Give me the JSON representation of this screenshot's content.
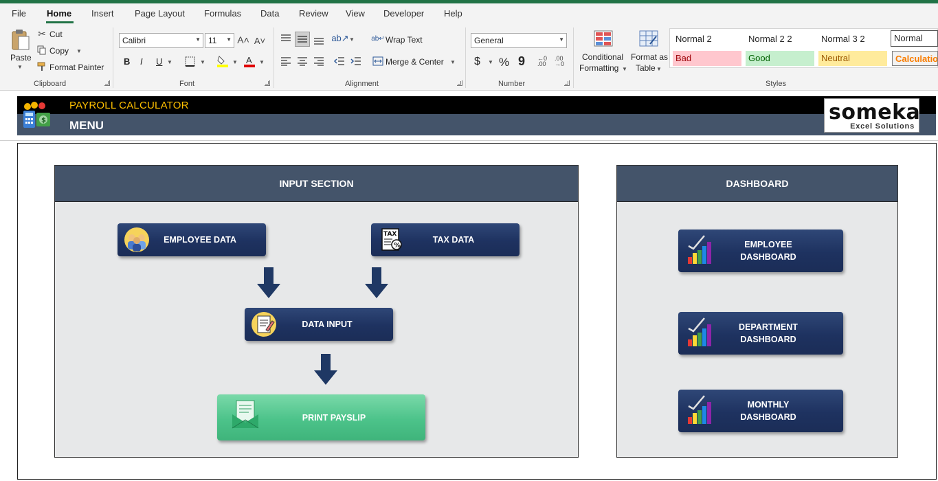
{
  "ribbon_tabs": [
    "File",
    "Home",
    "Insert",
    "Page Layout",
    "Formulas",
    "Data",
    "Review",
    "View",
    "Developer",
    "Help"
  ],
  "active_tab": "Home",
  "clipboard": {
    "paste": "Paste",
    "cut": "Cut",
    "copy": "Copy",
    "format_painter": "Format Painter",
    "group_label": "Clipboard"
  },
  "font": {
    "name": "Calibri",
    "size": "11",
    "group_label": "Font",
    "bold": "B",
    "italic": "I",
    "underline": "U"
  },
  "alignment": {
    "wrap_text": "Wrap Text",
    "merge_center": "Merge & Center",
    "group_label": "Alignment"
  },
  "number": {
    "format": "General",
    "group_label": "Number",
    "currency": "$",
    "percent": "%",
    "comma": "9"
  },
  "styles": {
    "conditional_formatting_line1": "Conditional",
    "conditional_formatting_line2": "Formatting",
    "format_as_table_line1": "Format as",
    "format_as_table_line2": "Table",
    "group_label": "Styles",
    "gallery": [
      {
        "label": "Normal 2",
        "bg": "#ffffff",
        "color": "#000000"
      },
      {
        "label": "Normal 2 2",
        "bg": "#ffffff",
        "color": "#000000"
      },
      {
        "label": "Normal 3 2",
        "bg": "#ffffff",
        "color": "#000000"
      },
      {
        "label": "Normal",
        "bg": "#ffffff",
        "color": "#000000"
      },
      {
        "label": "Bad",
        "bg": "#ffc7ce",
        "color": "#9c0006"
      },
      {
        "label": "Good",
        "bg": "#c6efce",
        "color": "#006100"
      },
      {
        "label": "Neutral",
        "bg": "#ffeb9c",
        "color": "#9c5700"
      },
      {
        "label": "Calculation",
        "bg": "#f2f2f2",
        "color": "#fa7d00"
      }
    ]
  },
  "sheet": {
    "title": "PAYROLL CALCULATOR",
    "menu": "MENU",
    "logo_word": "someka",
    "logo_sub": "Excel Solutions",
    "input_section": {
      "heading": "INPUT SECTION",
      "employee_data": "EMPLOYEE DATA",
      "tax_data": "TAX DATA",
      "data_input": "DATA INPUT",
      "print_payslip": "PRINT PAYSLIP"
    },
    "dashboard": {
      "heading": "DASHBOARD",
      "employee_l1": "EMPLOYEE",
      "employee_l2": "DASHBOARD",
      "department_l1": "DEPARTMENT",
      "department_l2": "DASHBOARD",
      "monthly_l1": "MONTHLY",
      "monthly_l2": "DASHBOARD"
    }
  },
  "colors": {
    "excel_green": "#217346",
    "header_slate": "#44546a",
    "title_gold": "#ffc000",
    "nav_button": "#1e3260",
    "payslip_green": "#4cc38a",
    "arrow_navy": "#1f3864"
  }
}
